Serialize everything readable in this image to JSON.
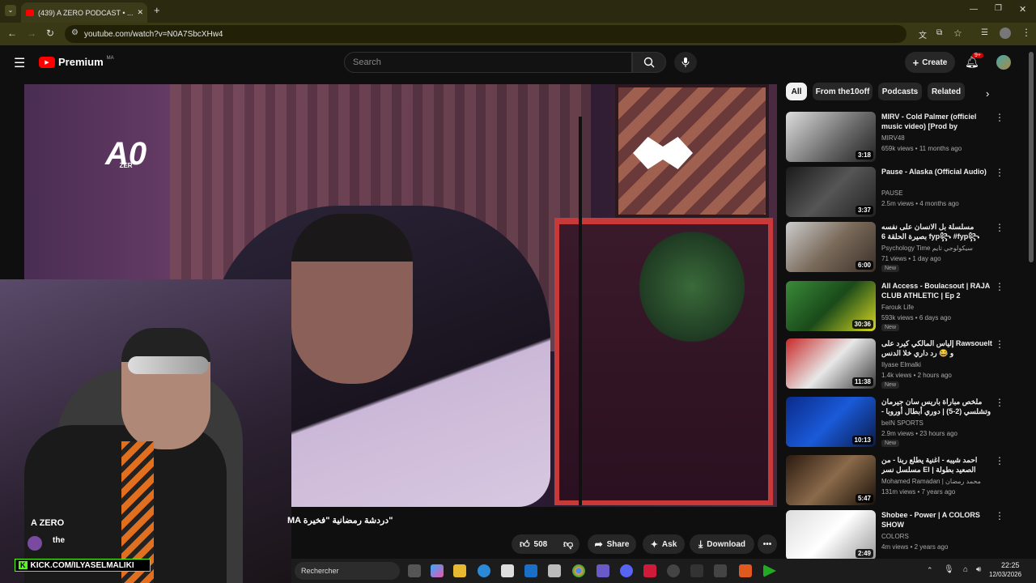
{
  "browser": {
    "tab_title": "(439) A ZERO PODCAST • ...",
    "url": "youtube.com/watch?v=N0A7SbcXHw4"
  },
  "header": {
    "logo": "Premium",
    "region": "MA",
    "search_placeholder": "Search",
    "create_label": "Create",
    "notif_badge": "9+"
  },
  "player": {
    "channel_logo": "A0",
    "channel_logo_sub": "ZER",
    "webcam_label_1": "A ZERO",
    "webcam_label_2": "the",
    "kick_text": "KICK.COM/ILYASELMALIKI"
  },
  "video": {
    "title": "MA دردشة رمضانية \"فخيرة\"",
    "likes": "508",
    "share_label": "Share",
    "ask_label": "Ask",
    "download_label": "Download"
  },
  "chips": [
    "All",
    "From the10off",
    "Podcasts",
    "Related"
  ],
  "recommendations": [
    {
      "title": "MIRV - Cold Palmer (officiel music video) [Prod by INSANNE]",
      "channel": "MIRV48",
      "meta": "659k views • 11 months ago",
      "duration": "3:18",
      "new": ""
    },
    {
      "title": "Pause - Alaska (Official Audio)",
      "channel": "PAUSE",
      "meta": "2.5m views • 4 months ago",
      "duration": "3:37",
      "new": ""
    },
    {
      "title": "مسلسلة بل الانسان على نفسه بصيرة الحلقة 6 fyp꧂ #fyp꧂#viral# التقوى و الوعي ...",
      "channel": "Psychology Time سيكولوجي تايم",
      "meta": "71 views • 1 day ago",
      "duration": "6:00",
      "new": "New"
    },
    {
      "title": "All Access - Boulacsout | RAJA CLUB ATHLETIC | Ep 2",
      "channel": "Farouk Life",
      "meta": "593k views • 6 days ago",
      "duration": "30:36",
      "new": "New"
    },
    {
      "title": "إلياس المالكي كيرد على Rawsouelt و 😂 رد داري خلا الدنس ElGrandeTot...",
      "channel": "Ilyase Elmalki",
      "meta": "1.4k views • 2 hours ago",
      "duration": "11:38",
      "new": "New"
    },
    {
      "title": "ملخص مباراة باريس سان جيرمان وتشلسي (2-5) | دوري أبطال أوروبا - ذهاب ثمن ...",
      "channel": "beIN SPORTS",
      "meta": "2.9m views • 23 hours ago",
      "duration": "10:13",
      "new": "New"
    },
    {
      "title": "احمد شيبه - اغنية يطلع ربنا - من مسلسل نسر El | الصعيد بطولة محمد رمضان Nesr ...",
      "channel": "Mohamed Ramadan | محمد رمضان",
      "meta": "131m views • 7 years ago",
      "duration": "5:47",
      "new": ""
    },
    {
      "title": "Shobee - Power | A COLORS SHOW",
      "channel": "COLORS",
      "meta": "4m views • 2 years ago",
      "duration": "2:49",
      "new": ""
    }
  ],
  "taskbar": {
    "search": "Rechercher",
    "time": "22:25",
    "date": "12/03/2026"
  }
}
